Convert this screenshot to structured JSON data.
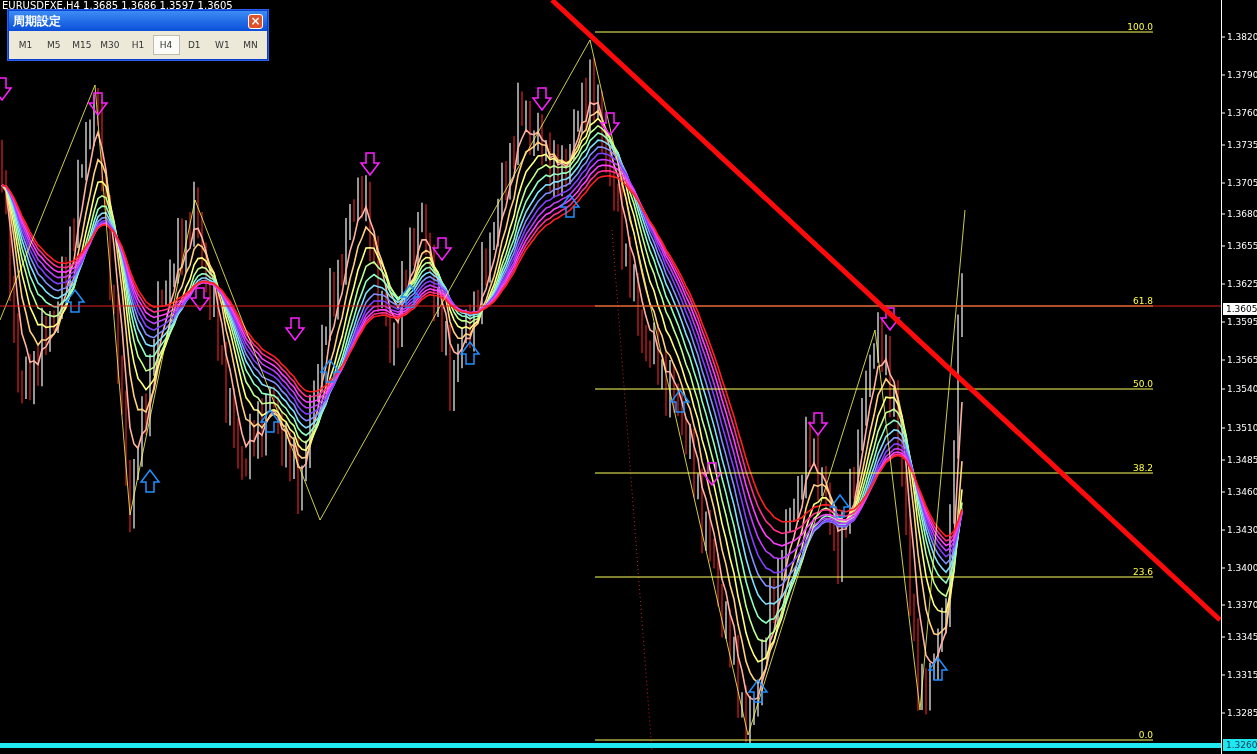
{
  "chart_header": "EURUSDFXE,H4  1.3685 1.3686 1.3597 1.3605",
  "period_dialog": {
    "title": "周期設定",
    "close": "×",
    "periods": [
      {
        "label": "M1",
        "selected": false
      },
      {
        "label": "M5",
        "selected": false
      },
      {
        "label": "M15",
        "selected": false
      },
      {
        "label": "M30",
        "selected": false
      },
      {
        "label": "H1",
        "selected": false
      },
      {
        "label": "H4",
        "selected": true
      },
      {
        "label": "D1",
        "selected": false
      },
      {
        "label": "W1",
        "selected": false
      },
      {
        "label": "MN",
        "selected": false
      }
    ]
  },
  "fibonacci_levels": [
    "100.0",
    "61.8",
    "50.0",
    "38.2",
    "23.6",
    "0.0"
  ],
  "price_axis": [
    "1.3820",
    "1.3790",
    "1.3760",
    "1.3735",
    "1.3705",
    "1.3680",
    "1.3655",
    "1.3625",
    "1.3595",
    "1.3565",
    "1.3540",
    "1.3510",
    "1.3485",
    "1.3460",
    "1.3430",
    "1.3400",
    "1.3370",
    "1.3345",
    "1.3315",
    "1.3285"
  ],
  "price_markers": [
    {
      "kind": "bid",
      "text": "1.3605"
    },
    {
      "kind": "line",
      "text": "1.3260"
    }
  ]
}
